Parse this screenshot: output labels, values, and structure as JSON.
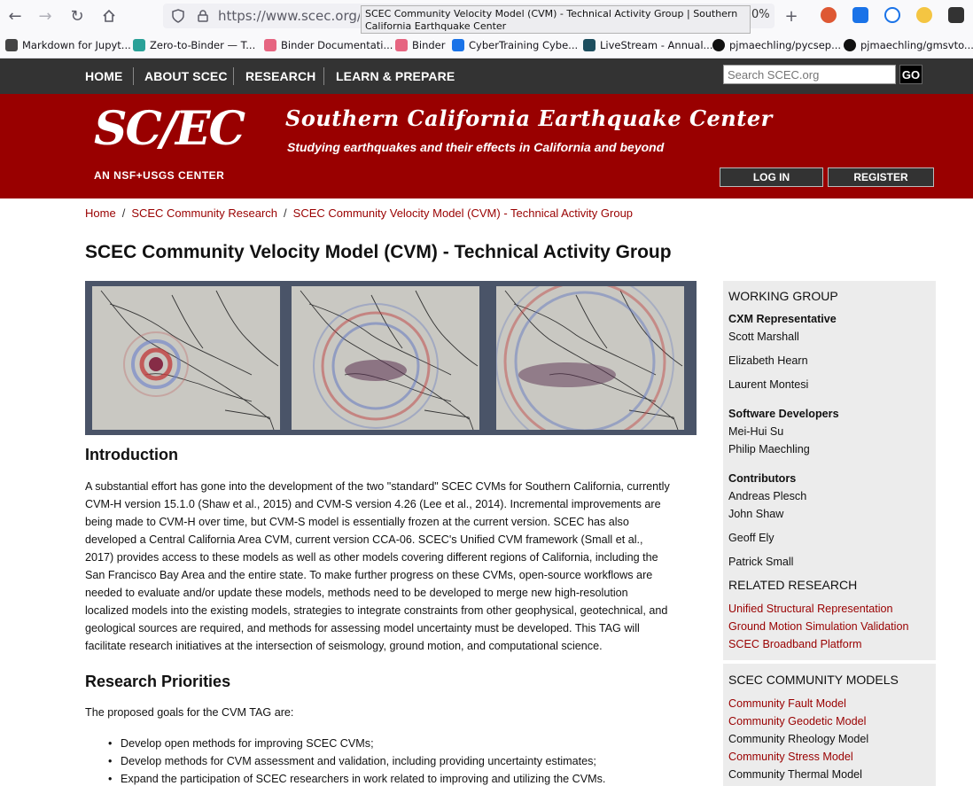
{
  "browser": {
    "url": "https://www.scec.org/rese",
    "tooltip": "SCEC Community Velocity Model (CVM) - Technical Activity Group | Southern California Earthquake Center",
    "zoom": "0%",
    "bookmarks": [
      {
        "label": "Markdown for Jupyt...",
        "color": "#444"
      },
      {
        "label": "Zero-to-Binder — T...",
        "color": "#2aa198"
      },
      {
        "label": "Binder Documentati...",
        "color": "#e66581"
      },
      {
        "label": "Binder",
        "color": "#e66581"
      },
      {
        "label": "CyberTraining Cybe...",
        "color": "#1a73e8"
      },
      {
        "label": "LiveStream - Annual...",
        "color": "#1d4e5f"
      },
      {
        "label": "pjmaechling/pycsep...",
        "color": "#111"
      },
      {
        "label": "pjmaechling/gmsvto...",
        "color": "#111"
      }
    ]
  },
  "nav": {
    "items": [
      "HOME",
      "ABOUT SCEC",
      "RESEARCH",
      "LEARN & PREPARE"
    ],
    "search_placeholder": "Search SCEC.org",
    "search_button": "GO"
  },
  "header": {
    "logo_text": "SC/EC",
    "logo_sub": "AN NSF+USGS CENTER",
    "title": "Southern California Earthquake Center",
    "tagline": "Studying earthquakes and their effects in California and beyond",
    "login": "LOG IN",
    "register": "REGISTER"
  },
  "breadcrumb": [
    "Home",
    "SCEC Community Research",
    "SCEC Community Velocity Model (CVM) - Technical Activity Group"
  ],
  "page_title": "SCEC Community Velocity Model (CVM) - Technical Activity Group",
  "intro": {
    "heading": "Introduction",
    "lines": [
      "A substantial effort has gone into the development of the two \"standard\" SCEC CVMs for Southern California, currently",
      "CVM-H version 15.1.0 (Shaw et al., 2015) and CVM-S version 4.26 (Lee et al., 2014). Incremental improvements are",
      "being made to CVM-H over time, but CVM-S model is essentially frozen at the current version. SCEC has also",
      "developed a Central California Area CVM, current version CCA-06. SCEC's Unified CVM framework (Small et al.,",
      "2017) provides access to these models as well as other models covering different regions of California, including the",
      "San Francisco Bay Area and the entire state. To make further progress on these CVMs, open-source workflows are",
      "needed to evaluate and/or update these models, methods need to be developed to merge new high-resolution",
      "localized models into the existing models, strategies to integrate constraints from other geophysical, geotechnical, and",
      "geological sources are required, and methods for assessing model uncertainty must be developed. This TAG will",
      "facilitate research initiatives at the intersection of seismology, ground motion, and computational science."
    ]
  },
  "priorities": {
    "heading": "Research Priorities",
    "lead": "The proposed goals for the CVM TAG are:",
    "bullets": [
      "Develop open methods for improving SCEC CVMs;",
      "Develop methods for CVM assessment and validation, including providing uncertainty estimates;",
      "Expand the participation of SCEC researchers in work related to improving and utilizing the CVMs."
    ]
  },
  "sidebar": {
    "working_group": "WORKING GROUP",
    "cxm_label": "CXM Representative",
    "cxm": [
      "Scott Marshall",
      "Elizabeth Hearn",
      "Laurent Montesi"
    ],
    "dev_label": "Software Developers",
    "devs": [
      "Mei-Hui Su",
      "Philip Maechling"
    ],
    "contrib_label": "Contributors",
    "contribs": [
      "Andreas Plesch",
      "John Shaw",
      "Geoff Ely",
      "Patrick Small"
    ],
    "related_label": "RELATED RESEARCH",
    "related": [
      "Unified Structural Representation",
      "Ground Motion Simulation Validation",
      "SCEC Broadband Platform"
    ],
    "models_label": "SCEC COMMUNITY MODELS",
    "models": [
      {
        "label": "Community Fault Model",
        "link": true
      },
      {
        "label": "Community Geodetic Model",
        "link": true
      },
      {
        "label": "Community Rheology Model",
        "link": false
      },
      {
        "label": "Community Stress Model",
        "link": true
      },
      {
        "label": "Community Thermal Model",
        "link": false
      }
    ]
  },
  "colors": {
    "brand": "#990000",
    "nav": "#333333",
    "sidebar": "#ececec"
  }
}
